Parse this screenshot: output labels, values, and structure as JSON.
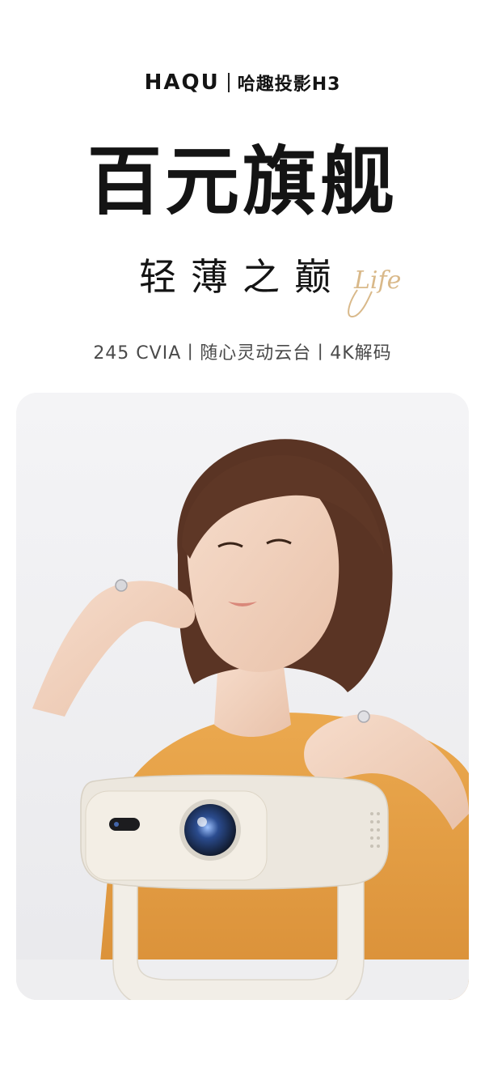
{
  "brand": {
    "name": "HAQU",
    "model": "哈趣投影H3"
  },
  "headline": "百元旗舰",
  "subheadline": "轻薄之巅",
  "script_word": "Life",
  "specs": "245 CVIA丨随心灵动云台丨4K解码",
  "colors": {
    "text": "#141414",
    "accent_gold": "#d9b98a",
    "shirt": "#e8a24a",
    "projector": "#ece7de"
  },
  "hero_image": {
    "subject": "woman-with-projector"
  }
}
